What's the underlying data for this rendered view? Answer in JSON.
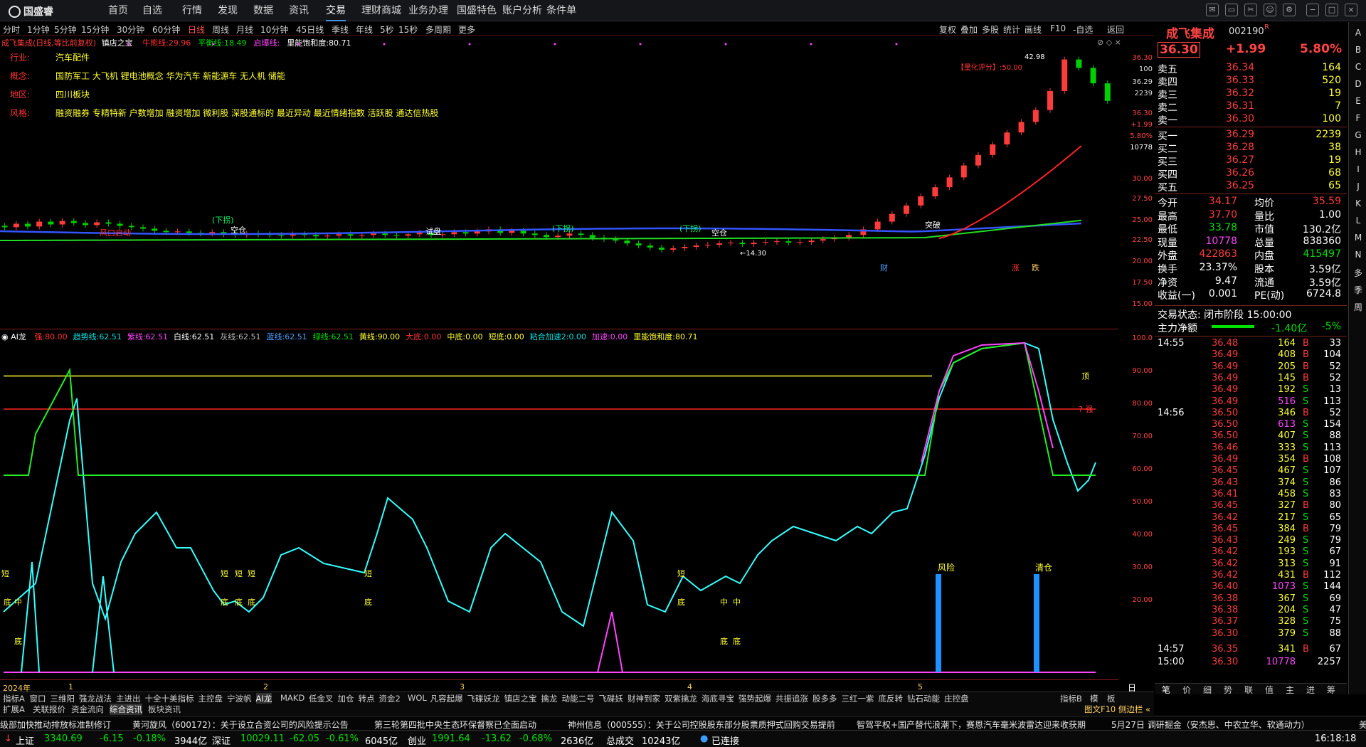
{
  "app": {
    "name": "国盛睿"
  },
  "nav": [
    "首页",
    "自选",
    "行情",
    "发现",
    "数据",
    "资讯",
    "交易",
    "理财商城",
    "业务办理",
    "国盛特色",
    "账户分析",
    "条件单"
  ],
  "nav_active": "交易",
  "periods": [
    "分时",
    "1分钟",
    "5分钟",
    "15分钟",
    "30分钟",
    "60分钟",
    "日线",
    "周线",
    "月线",
    "10分钟",
    "45日线",
    "季线",
    "年线",
    "5秒",
    "15秒",
    "多周期",
    "更多"
  ],
  "period_selected": "日线",
  "right_tools": [
    "复权",
    "叠加",
    "多股",
    "统计",
    "画线",
    "F10",
    "-自选",
    "返回"
  ],
  "main_legend": {
    "stock": "成飞集成(日线,等比前复权)",
    "indicator": "镇店之宝",
    "items": [
      {
        "label": "牛熊线:",
        "value": "29.96",
        "color": "#ff3333"
      },
      {
        "label": "平衡线:",
        "value": "18.49",
        "color": "#00e000"
      },
      {
        "label": "启爆线:",
        "value": "",
        "color": "#ff44ff"
      },
      {
        "label": "里能饱和度:",
        "value": "80.71",
        "color": "#ffffff"
      }
    ]
  },
  "stock_info": [
    {
      "label": "行业:",
      "value": "汽车配件"
    },
    {
      "label": "概念:",
      "value": "国防军工 大飞机 锂电池概念 华为汽车 新能源车 无人机 储能"
    },
    {
      "label": "地区:",
      "value": "四川板块"
    },
    {
      "label": "风格:",
      "value": "融资融券 专精特新 户数增加 融资增加 微利股 深股通标的 最近异动 最近情绪指数 活跃股 通达信热股"
    }
  ],
  "yaxis_main": [
    "36.30",
    "100",
    "36.29",
    "2239",
    "36.30",
    "+1.99",
    "5.80%",
    "10778",
    "30.00",
    "27.50",
    "25.00",
    "22.50",
    "20.00",
    "17.50",
    "15.00"
  ],
  "main_annotations": {
    "peak": "42.98",
    "low": "14.30",
    "score": "【量化评分】:50.00",
    "labels": [
      "风口启动",
      "空仓",
      "试盘",
      "空仓",
      "(下拐)",
      "(下拐)",
      "(下拐)",
      "突破",
      "财",
      "涨",
      "跌"
    ]
  },
  "sub_legend": {
    "name": "AI龙",
    "items": [
      {
        "label": "强:",
        "value": "80.00",
        "color": "#ff3333"
      },
      {
        "label": "趋势线:",
        "value": "62.51",
        "color": "#00e0e0"
      },
      {
        "label": "紫线:",
        "value": "62.51",
        "color": "#ff44ff"
      },
      {
        "label": "白线:",
        "value": "62.51",
        "color": "#ffffff"
      },
      {
        "label": "灰线:",
        "value": "62.51",
        "color": "#bbbbbb"
      },
      {
        "label": "蓝线:",
        "value": "62.51",
        "color": "#4aa0ff"
      },
      {
        "label": "绿线:",
        "value": "62.51",
        "color": "#00e000"
      },
      {
        "label": "黄线:",
        "value": "90.00",
        "color": "#ffff33"
      },
      {
        "label": "大底:",
        "value": "0.00",
        "color": "#ff3333"
      },
      {
        "label": "中底:",
        "value": "0.00",
        "color": "#ffff33"
      },
      {
        "label": "短底:",
        "value": "0.00",
        "color": "#ffff33"
      },
      {
        "label": "粘合加速2:",
        "value": "0.00",
        "color": "#00e0e0"
      },
      {
        "label": "加速:",
        "value": "0.00",
        "color": "#ff44ff"
      },
      {
        "label": "里能饱和度:",
        "value": "80.71",
        "color": "#ffff33"
      }
    ]
  },
  "yaxis_sub": [
    "100.0",
    "90.00",
    "80.00",
    "70.00",
    "60.00",
    "50.00",
    "40.00",
    "30.00",
    "20.00"
  ],
  "sub_labels": {
    "top": "顶",
    "strong": "? 强",
    "risk": "风险",
    "clear": "清仓",
    "short": "短",
    "bottom": "底",
    "mid": "中"
  },
  "xaxis": [
    "2024年",
    "1",
    "2",
    "3",
    "4",
    "5"
  ],
  "xaxis_right": "日线",
  "tabs": [
    "指标A",
    "窗口",
    "三维阳",
    "强龙战法",
    "主进出",
    "十全十美指标",
    "主控盘",
    "宁波帆",
    "AI龙",
    "MAKD",
    "低金叉",
    "加仓",
    "转点",
    "资金2",
    "WOL",
    "凡容起爆",
    "飞碟妖龙",
    "镇店之宝",
    "擒龙",
    "动能二号",
    "飞碟妖",
    "财神到家",
    "双紫擒龙",
    "海底寻宝",
    "强势起爆",
    "共振追涨",
    "股多多",
    "三红一紫",
    "底反转",
    "钻石动能",
    "庄控盘"
  ],
  "tabs_active": "AI龙",
  "tabs_right": [
    "指标B",
    "模",
    "板"
  ],
  "tabs2": [
    "扩展A",
    "关联报价",
    "资金流向",
    "综合资讯",
    "板块资讯"
  ],
  "tabs2_right": "图文F10 侧边栏 «",
  "ticker": [
    "级部加快推动排放标准制修订",
    "黄河旋风（600172）：关于设立合资公司的风险提示公告",
    "第三轮第四批中央生态环保督察已全面启动",
    "神州信息（000555）：关于公司控股股东部分股票质押式回购交易提前",
    "智驾平权+国产替代浪潮下，赛恩汽车毫米波雷达迎来收获期",
    "5月27日 调研掘金（安杰思、中农立华、软通动力）",
    "美"
  ],
  "status": {
    "sh": {
      "name": "上证",
      "value": "3340.69",
      "chg": "-6.15",
      "pct": "-0.18%",
      "amt": "3944亿"
    },
    "sz": {
      "name": "深证",
      "value": "10029.11",
      "chg": "-62.05",
      "pct": "-0.61%",
      "amt": "6045亿"
    },
    "cy": {
      "name": "创业",
      "value": "1991.64",
      "chg": "-13.62",
      "pct": "-0.68%",
      "amt": "2636亿"
    },
    "total_label": "总成交",
    "total": "10243亿",
    "conn": "已连接",
    "time": "16:18:18"
  },
  "quote": {
    "name": "成飞集成",
    "code": "002190",
    "badge": "R",
    "price": "36.30",
    "change": "+1.99",
    "pct": "5.80%",
    "asks": [
      [
        "卖五",
        "36.34",
        "164"
      ],
      [
        "卖四",
        "36.33",
        "520"
      ],
      [
        "卖三",
        "36.32",
        "19"
      ],
      [
        "卖二",
        "36.31",
        "7"
      ],
      [
        "卖一",
        "36.30",
        "100"
      ]
    ],
    "bids": [
      [
        "买一",
        "36.29",
        "2239"
      ],
      [
        "买二",
        "36.28",
        "38"
      ],
      [
        "买三",
        "36.27",
        "19"
      ],
      [
        "买四",
        "36.26",
        "68"
      ],
      [
        "买五",
        "36.25",
        "65"
      ]
    ],
    "stats": [
      [
        "今开",
        "34.17",
        "均价",
        "35.59"
      ],
      [
        "最高",
        "37.70",
        "量比",
        "1.00"
      ],
      [
        "最低",
        "33.78",
        "市值",
        "130.2亿"
      ],
      [
        "现量",
        "10778",
        "总量",
        "838360"
      ],
      [
        "外盘",
        "422863",
        "内盘",
        "415497"
      ],
      [
        "换手",
        "23.37%",
        "股本",
        "3.59亿"
      ],
      [
        "净资",
        "9.47",
        "流通",
        "3.59亿"
      ],
      [
        "收益(一)",
        "0.001",
        "PE(动)",
        "6724.8"
      ]
    ],
    "trade_state": "交易状态: 闭市阶段 15:00:00",
    "main_net_label": "主力净额",
    "main_net": "-1.40亿",
    "main_net_pct": "-5%",
    "ticks": [
      [
        "14:55",
        "36.48",
        "164",
        "B",
        "33"
      ],
      [
        "",
        "36.49",
        "408",
        "B",
        "104"
      ],
      [
        "",
        "36.49",
        "205",
        "B",
        "52"
      ],
      [
        "",
        "36.49",
        "145",
        "B",
        "52"
      ],
      [
        "",
        "36.49",
        "192",
        "S",
        "13"
      ],
      [
        "",
        "36.49",
        "516",
        "S",
        "113"
      ],
      [
        "14:56",
        "36.50",
        "346",
        "B",
        "52"
      ],
      [
        "",
        "36.50",
        "613",
        "S",
        "154"
      ],
      [
        "",
        "36.50",
        "407",
        "S",
        "88"
      ],
      [
        "",
        "36.46",
        "333",
        "S",
        "113"
      ],
      [
        "",
        "36.49",
        "354",
        "B",
        "108"
      ],
      [
        "",
        "36.45",
        "467",
        "S",
        "107"
      ],
      [
        "",
        "36.43",
        "374",
        "S",
        "86"
      ],
      [
        "",
        "36.41",
        "458",
        "S",
        "83"
      ],
      [
        "",
        "36.45",
        "327",
        "B",
        "80"
      ],
      [
        "",
        "36.42",
        "217",
        "S",
        "65"
      ],
      [
        "",
        "36.45",
        "384",
        "B",
        "79"
      ],
      [
        "",
        "36.43",
        "249",
        "S",
        "79"
      ],
      [
        "",
        "36.42",
        "193",
        "S",
        "67"
      ],
      [
        "",
        "36.42",
        "313",
        "S",
        "91"
      ],
      [
        "",
        "36.42",
        "431",
        "B",
        "112"
      ],
      [
        "",
        "36.40",
        "1073",
        "S",
        "144"
      ],
      [
        "",
        "36.38",
        "367",
        "S",
        "69"
      ],
      [
        "",
        "36.38",
        "204",
        "S",
        "47"
      ],
      [
        "",
        "36.37",
        "328",
        "S",
        "75"
      ],
      [
        "",
        "36.30",
        "379",
        "S",
        "88"
      ],
      [
        "14:57",
        "36.35",
        "341",
        "B",
        "67"
      ],
      [
        "15:00",
        "36.30",
        "10778",
        "",
        "2257"
      ]
    ],
    "bottom_tabs": [
      "笔",
      "价",
      "细",
      "势",
      "联",
      "值",
      "主",
      "进",
      "筹"
    ]
  },
  "side_tabs": [
    "A",
    "B",
    "C",
    "D",
    "E",
    "F",
    "G",
    "H",
    "I",
    "J",
    "K",
    "L",
    "M",
    "N",
    "多",
    "季",
    "周"
  ]
}
